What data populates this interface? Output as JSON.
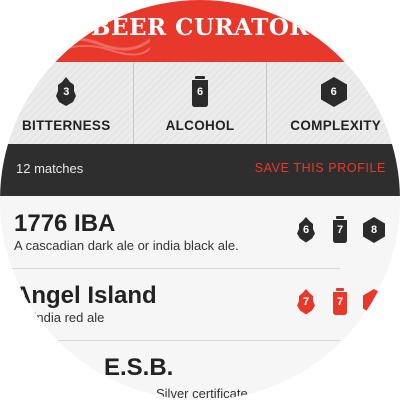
{
  "header": {
    "title": "BEER CURATOR"
  },
  "filters": [
    {
      "label": "BITTERNESS",
      "value": "3",
      "icon": "hop-icon"
    },
    {
      "label": "ALCOHOL",
      "value": "6",
      "icon": "can-icon"
    },
    {
      "label": "COMPLEXITY",
      "value": "6",
      "icon": "hexagon-icon"
    }
  ],
  "status": {
    "match_count": "12 matches",
    "save_label": "SAVE THIS PROFILE"
  },
  "beers": [
    {
      "name": "1776 IBA",
      "description": "A cascadian dark ale or india black ale.",
      "bitterness": "6",
      "alcohol": "7",
      "complexity": "8"
    },
    {
      "name": "Angel Island",
      "description": "An india red ale",
      "bitterness": "7",
      "alcohol": "7",
      "complexity": ""
    },
    {
      "name": "E.S.B.",
      "description": "Silver certificate"
    }
  ],
  "colors": {
    "accent": "#e8382b",
    "dark": "#2e2e2e",
    "icon_dark": "#2b2b2b"
  }
}
